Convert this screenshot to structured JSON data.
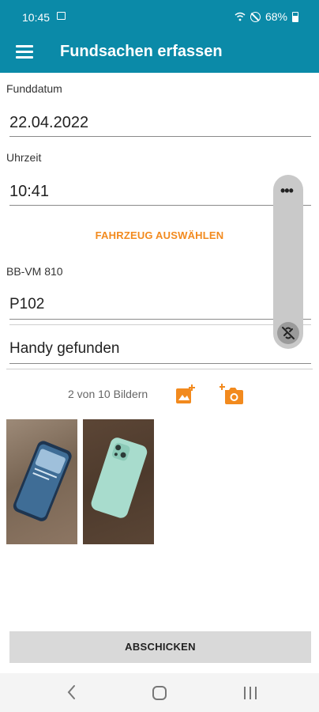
{
  "status": {
    "time": "10:45",
    "battery": "68%"
  },
  "appbar": {
    "title": "Fundsachen erfassen",
    "menu_icon": "hamburger-icon"
  },
  "form": {
    "date_label": "Funddatum",
    "date_value": "22.04.2022",
    "time_label": "Uhrzeit",
    "time_value": "10:41",
    "vehicle_button": "FAHRZEUG AUSWÄHLEN",
    "vehicle_plate": "BB-VM 810",
    "vehicle_value": "P102",
    "description_value": "Handy gefunden"
  },
  "images": {
    "count_text": "2 von 10 Bildern",
    "add_gallery_icon": "add-photo-icon",
    "add_camera_icon": "add-camera-icon",
    "accent_color": "#f28a1e"
  },
  "submit": {
    "label": "ABSCHICKEN"
  },
  "colors": {
    "primary": "#0b8aa8",
    "accent": "#f28a1e"
  }
}
